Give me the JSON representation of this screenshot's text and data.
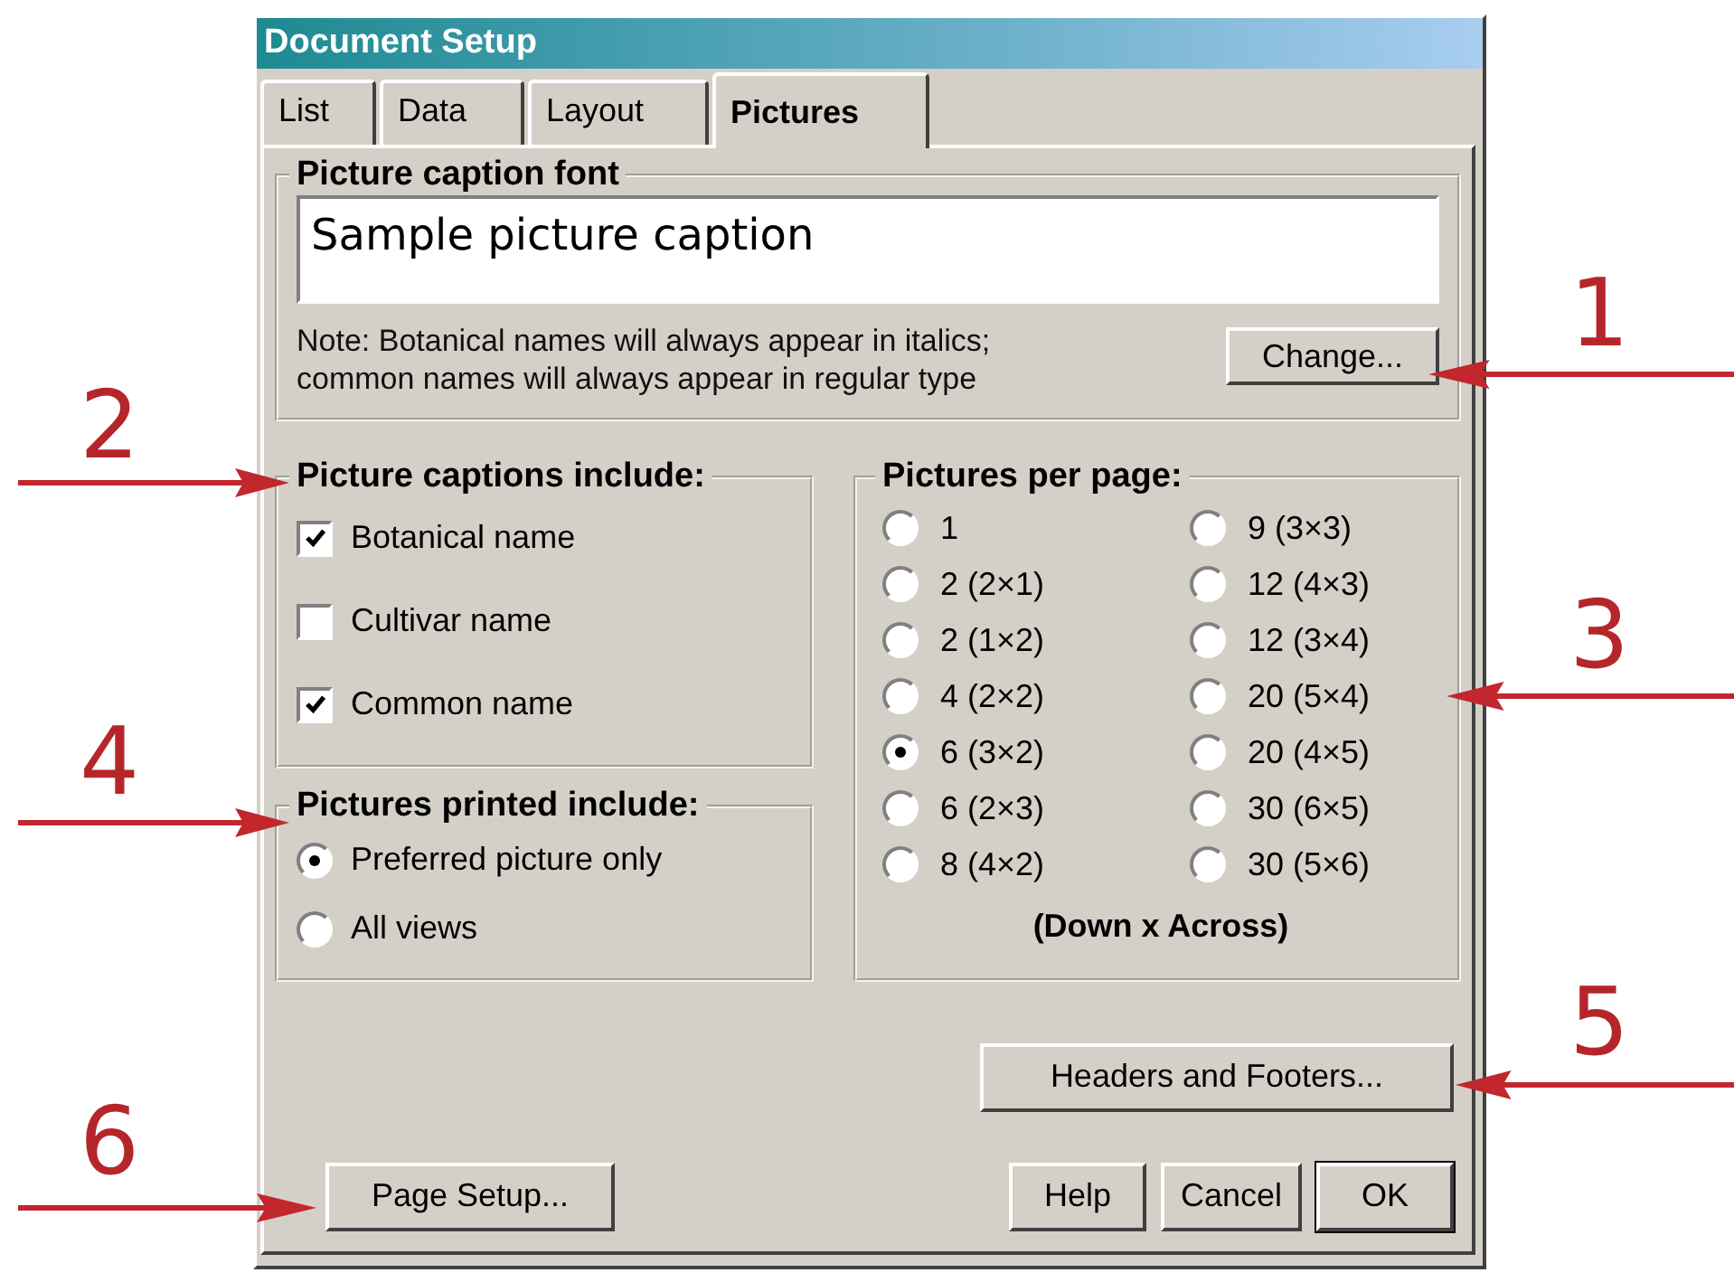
{
  "window": {
    "title": "Document Setup"
  },
  "tabs": [
    {
      "label": "List",
      "selected": false
    },
    {
      "label": "Data",
      "selected": false
    },
    {
      "label": "Layout",
      "selected": false
    },
    {
      "label": "Pictures",
      "selected": true
    }
  ],
  "caption_font": {
    "title": "Picture caption font",
    "sample": "Sample picture caption",
    "note": "Note: Botanical names will always appear in italics;\ncommon names will always appear in regular type",
    "button": "Change..."
  },
  "captions_include": {
    "title": "Picture captions include:",
    "options": [
      {
        "label": "Botanical name",
        "checked": true
      },
      {
        "label": "Cultivar name",
        "checked": false
      },
      {
        "label": "Common name",
        "checked": true
      }
    ]
  },
  "pictures_printed": {
    "title": "Pictures printed include:",
    "options": [
      {
        "label": "Preferred picture only",
        "selected": true
      },
      {
        "label": "All views",
        "selected": false
      }
    ]
  },
  "pictures_per_page": {
    "title": "Pictures per page:",
    "options": [
      {
        "label": "1",
        "selected": false
      },
      {
        "label": "2 (2×1)",
        "selected": false
      },
      {
        "label": "2 (1×2)",
        "selected": false
      },
      {
        "label": "4 (2×2)",
        "selected": false
      },
      {
        "label": "6 (3×2)",
        "selected": true
      },
      {
        "label": "6 (2×3)",
        "selected": false
      },
      {
        "label": "8 (4×2)",
        "selected": false
      },
      {
        "label": "9 (3×3)",
        "selected": false
      },
      {
        "label": "12 (4×3)",
        "selected": false
      },
      {
        "label": "12 (3×4)",
        "selected": false
      },
      {
        "label": "20 (5×4)",
        "selected": false
      },
      {
        "label": "20 (4×5)",
        "selected": false
      },
      {
        "label": "30 (6×5)",
        "selected": false
      },
      {
        "label": "30 (5×6)",
        "selected": false
      }
    ],
    "note": "(Down x Across)"
  },
  "headers_button": "Headers and Footers...",
  "page_setup_button": "Page Setup...",
  "buttons": [
    {
      "label": "Help",
      "default": false
    },
    {
      "label": "Cancel",
      "default": false
    },
    {
      "label": "OK",
      "default": true
    }
  ],
  "annotations": [
    {
      "number": "1",
      "kind": "right"
    },
    {
      "number": "2",
      "kind": "left"
    },
    {
      "number": "3",
      "kind": "right"
    },
    {
      "number": "4",
      "kind": "left"
    },
    {
      "number": "5",
      "kind": "right"
    },
    {
      "number": "6",
      "kind": "left"
    }
  ]
}
